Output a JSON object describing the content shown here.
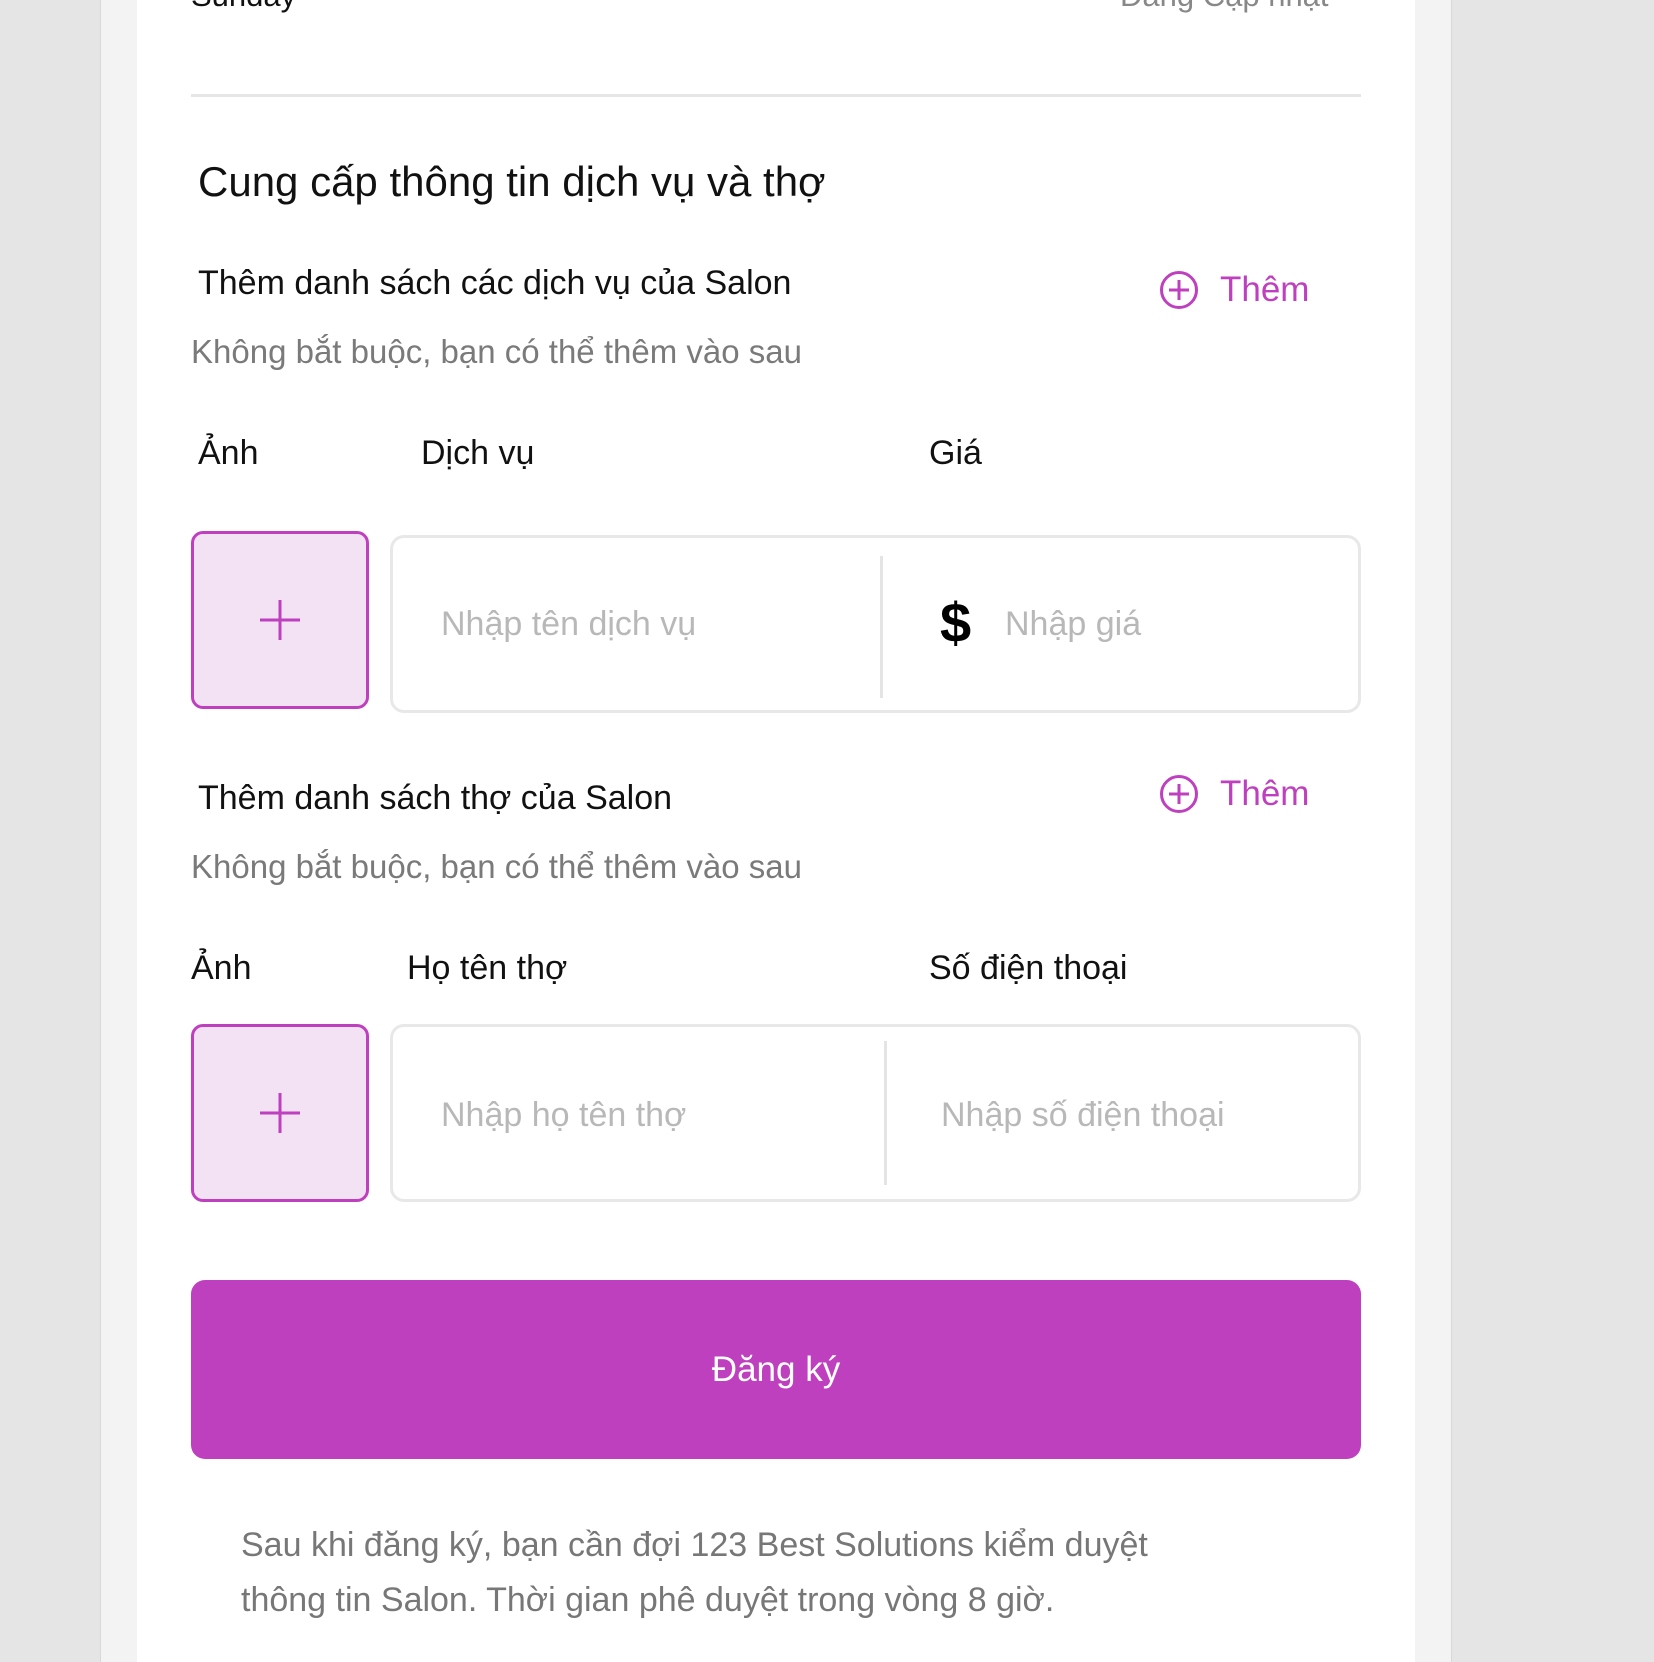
{
  "top_row": {
    "day_label": "Sunday",
    "status_label": "Đang Cập nhật"
  },
  "section": {
    "title": "Cung cấp thông tin dịch vụ và thợ"
  },
  "services": {
    "title": "Thêm danh sách các dịch vụ của Salon",
    "add_label": "Thêm",
    "hint": "Không bắt buộc, bạn có thể thêm vào sau",
    "col_photo": "Ảnh",
    "col_service": "Dịch vụ",
    "col_price": "Giá",
    "service_placeholder": "Nhập tên dịch vụ",
    "price_placeholder": "Nhập giá",
    "currency_symbol": "$"
  },
  "staff": {
    "title": "Thêm danh sách thợ của Salon",
    "add_label": "Thêm",
    "hint": "Không bắt buộc, bạn có thể thêm vào sau",
    "col_photo": "Ảnh",
    "col_name": "Họ tên thợ",
    "col_phone": "Số điện thoại",
    "name_placeholder": "Nhập họ tên thợ",
    "phone_placeholder": "Nhập số điện thoại"
  },
  "submit": {
    "label": "Đăng ký"
  },
  "note": {
    "line1": "Sau khi đăng ký, bạn cần đợi 123 Best Solutions kiểm duyệt",
    "line2": "thông tin Salon. Thời gian phê duyệt trong vòng 8 giờ."
  },
  "colors": {
    "accent": "#bf40bf",
    "accent_light": "#f3e1f4",
    "hint_text": "#7a7a7a",
    "placeholder_text": "#b8b8b8"
  },
  "icons": {
    "add": "plus-circle-icon",
    "photo_add": "plus-icon",
    "currency": "dollar-icon"
  }
}
